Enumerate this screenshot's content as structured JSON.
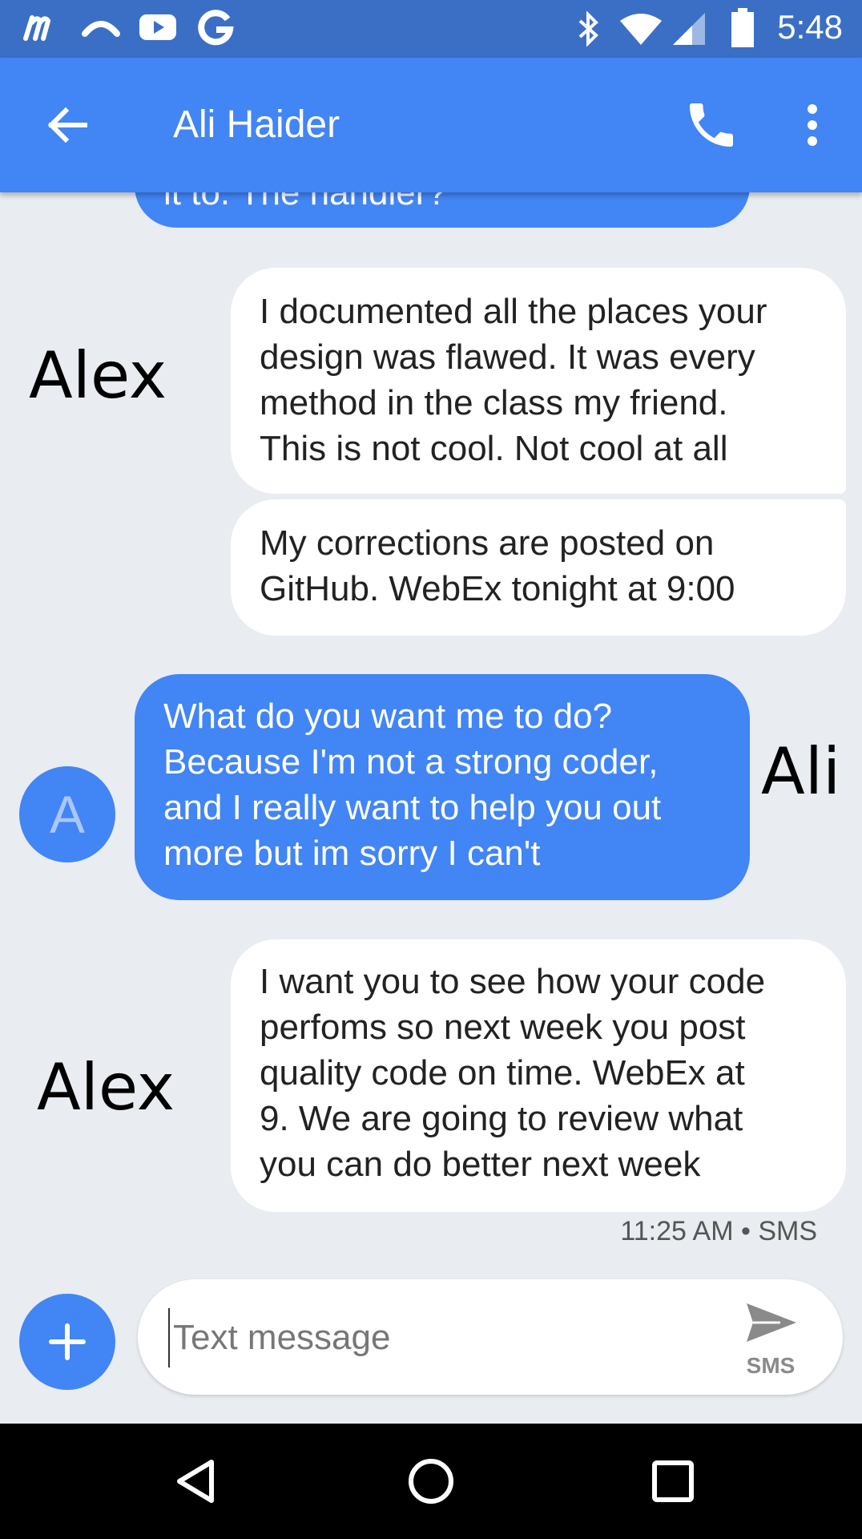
{
  "status_bar": {
    "time": "5:48",
    "left_icons": [
      "m-app-icon",
      "hangouts-icon",
      "youtube-icon",
      "google-icon"
    ],
    "right_icons": [
      "bluetooth-icon",
      "wifi-icon",
      "cell-signal-icon",
      "battery-icon"
    ]
  },
  "app_bar": {
    "title": "Ali Haider",
    "icons": [
      "back-arrow-icon",
      "phone-icon",
      "more-vert-icon"
    ]
  },
  "messages": [
    {
      "direction": "outgoing",
      "lines": [
        "it to. The handler?"
      ]
    },
    {
      "direction": "incoming",
      "lines": [
        "I documented all the places your",
        "design was flawed. It was every",
        "method in the class my friend.",
        "This is not cool. Not cool at all"
      ]
    },
    {
      "direction": "incoming",
      "lines": [
        "My corrections are posted on",
        "GitHub. WebEx tonight at 9:00"
      ]
    },
    {
      "direction": "outgoing",
      "lines": [
        "What do you want me to do?",
        "Because I'm not a strong coder,",
        "and I really want to help you out",
        "more but im sorry I can't"
      ]
    },
    {
      "direction": "incoming",
      "lines": [
        "I want you to see how your code",
        "perfoms so next week you post",
        "quality code on time. WebEx at",
        "9. We are going to review what",
        "you can do better next week"
      ]
    }
  ],
  "avatar": {
    "letter": "A",
    "color": "#4285f4"
  },
  "annotations": {
    "alex_1": "Alex",
    "ali": "Ali",
    "alex_2": "Alex"
  },
  "timestamp": "11:25 AM • SMS",
  "composer": {
    "placeholder": "Text message",
    "value": "",
    "send_label": "SMS"
  },
  "nav_bar": {
    "icons": [
      "back-triangle-icon",
      "home-circle-icon",
      "recents-square-icon"
    ]
  },
  "colors": {
    "accent": "#4285f4",
    "status_bar": "#3b6fc6",
    "background": "#e9ecf0"
  }
}
